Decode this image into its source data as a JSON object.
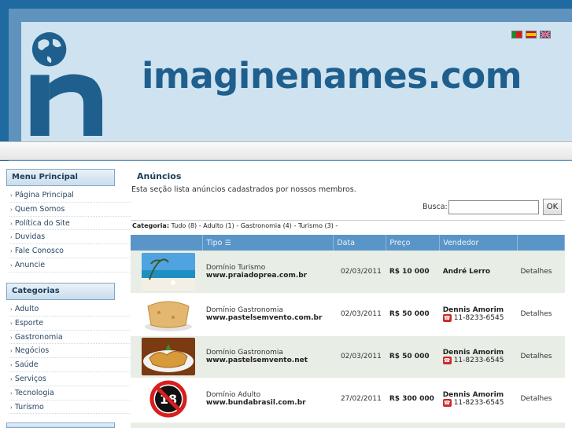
{
  "brand": "imaginenames.com",
  "flags": [
    "pt-flag",
    "es-flag",
    "en-flag"
  ],
  "sidebar": {
    "menu_title": "Menu Principal",
    "menu_items": [
      "Página Principal",
      "Quem Somos",
      "Política do Site",
      "Duvidas",
      "Fale Conosco",
      "Anuncie"
    ],
    "cat_title": "Categorias",
    "cat_items": [
      "Adulto",
      "Esporte",
      "Gastronomia",
      "Negócios",
      "Saúde",
      "Serviços",
      "Tecnologia",
      "Turismo"
    ]
  },
  "main": {
    "title": "Anúncios",
    "description": "Esta seção lista anúncios cadastrados por nossos membros.",
    "search_label": "Busca:",
    "search_value": "",
    "ok_label": "OK",
    "categoria_label": "Categoria:",
    "categoria_links": "Tudo (8)  -  Adulto (1)  -  Gastronomia (4)  -  Turismo (3)  -"
  },
  "table": {
    "headers": [
      "",
      "Tipo",
      "Data",
      "Preço",
      "Vendedor",
      ""
    ],
    "rows": [
      {
        "thumb": "beach-image",
        "tipo": "Domínio Turismo",
        "dominio": "www.praiadoprea.com.br",
        "data": "02/03/2011",
        "preco": "R$ 10 000",
        "vendedor": "André Lerro",
        "telefone": "",
        "detalhes": "Detalhes"
      },
      {
        "thumb": "pastel-image",
        "tipo": "Domínio Gastronomia",
        "dominio": "www.pastelsemvento.com.br",
        "data": "02/03/2011",
        "preco": "R$ 50 000",
        "vendedor": "Dennis Amorim",
        "telefone": "11-8233-6545",
        "detalhes": "Detalhes"
      },
      {
        "thumb": "pastel-plate-image",
        "tipo": "Domínio Gastronomia",
        "dominio": "www.pastelsemvento.net",
        "data": "02/03/2011",
        "preco": "R$ 50 000",
        "vendedor": "Dennis Amorim",
        "telefone": "11-8233-6545",
        "detalhes": "Detalhes"
      },
      {
        "thumb": "adult-18-image",
        "tipo": "Domínio Adulto",
        "dominio": "www.bundabrasil.com.br",
        "data": "27/02/2011",
        "preco": "R$ 300 000",
        "vendedor": "Dennis Amorim",
        "telefone": "11-8233-6545",
        "detalhes": "Detalhes"
      }
    ]
  }
}
